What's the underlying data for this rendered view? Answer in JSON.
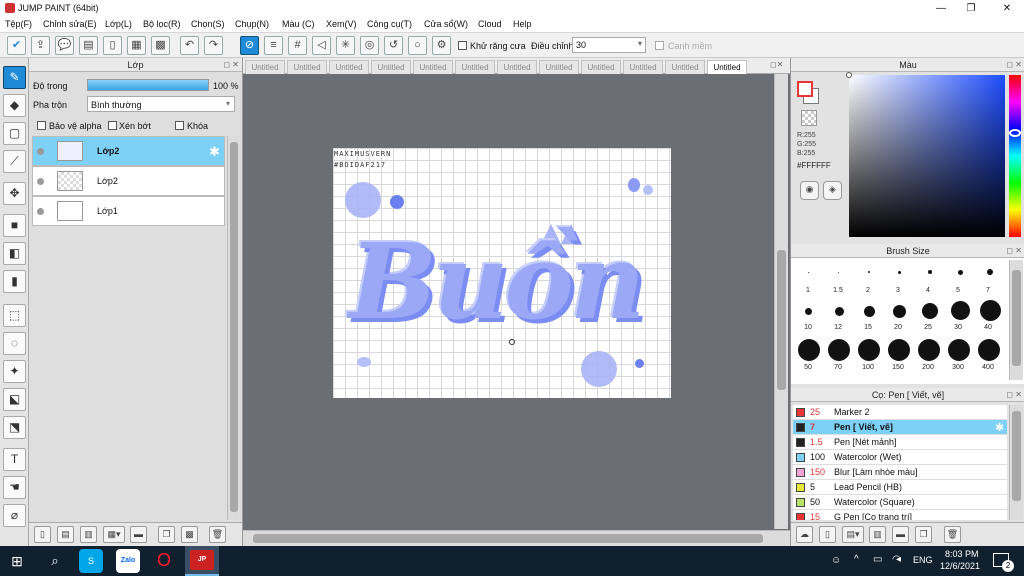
{
  "window": {
    "title": "JUMP PAINT (64bit)",
    "min": "—",
    "max": "❐",
    "close": "✕"
  },
  "menu": [
    "Tệp(F)",
    "Chỉnh sửa(E)",
    "Lớp(L)",
    "Bộ lọc(R)",
    "Chọn(S)",
    "Chụp(N)",
    "Màu (C)",
    "Xem(V)",
    "Công cụ(T)",
    "Cửa sổ(W)",
    "Cloud",
    "Help"
  ],
  "toolbar": {
    "antialias_label": "Khử răng cưa",
    "adjust_label": "Điều chỉnh",
    "adjust_value": "30",
    "snap_label": "Canh mềm"
  },
  "layer_panel": {
    "title": "Lớp",
    "opacity_label": "Độ trong",
    "opacity_value": "100 %",
    "opacity_fraction": 1.0,
    "blend_label": "Pha trộn",
    "blend_value": "Bình thường",
    "protect_alpha": "Bảo vệ alpha",
    "clip": "Xén bớt",
    "lock": "Khóa",
    "layers": [
      {
        "name": "Lớp2",
        "selected": true
      },
      {
        "name": "Lớp2",
        "selected": false
      },
      {
        "name": "Lớp1",
        "selected": false
      }
    ]
  },
  "tabs": [
    "Untitled",
    "Untitled",
    "Untitled",
    "Untitled",
    "Untitled",
    "Untitled",
    "Untitled",
    "Untitled",
    "Untitled",
    "Untitled",
    "Untitled",
    "Untitled"
  ],
  "active_tab": 11,
  "artwork": {
    "main_text": "Buồn",
    "corner_text_1": "MAXIMUSVERN",
    "corner_text_2": "#BOIDAF217",
    "fill_color": "#9aa8f5",
    "shade_color": "#6b7ff0"
  },
  "color_panel": {
    "title": "Màu",
    "r": "R:255",
    "g": "G:255",
    "b": "B:255",
    "hex": "#FFFFFF"
  },
  "brush_size_panel": {
    "title": "Brush Size",
    "sizes": [
      "1",
      "1.5",
      "2",
      "3",
      "4",
      "5",
      "7",
      "10",
      "12",
      "15",
      "20",
      "25",
      "30",
      "40",
      "50",
      "70",
      "100",
      "150",
      "200",
      "300",
      "400"
    ]
  },
  "brush_panel": {
    "title": "Cọ: Pen [ Viết, vẽ]",
    "brushes": [
      {
        "size": "25",
        "name": "Marker 2",
        "color": "#e83535",
        "selected": false
      },
      {
        "size": "7",
        "name": "Pen [ Viết, vẽ]",
        "color": "#222222",
        "selected": true
      },
      {
        "size": "1.5",
        "name": "Pen [Nét mảnh]",
        "color": "#222222",
        "selected": false
      },
      {
        "size": "100",
        "name": "Watercolor (Wet)",
        "color": "#7fd3f2",
        "selected": false
      },
      {
        "size": "150",
        "name": "Blur [Làm nhòe màu]",
        "color": "#f4a3d6",
        "selected": false
      },
      {
        "size": "5",
        "name": "Lead Pencil (HB)",
        "color": "#e8e83a",
        "selected": false
      },
      {
        "size": "50",
        "name": "Watercolor (Square)",
        "color": "#b8e26a",
        "selected": false
      },
      {
        "size": "15",
        "name": "G Pen [Cọ trang trí]",
        "color": "#e83535",
        "selected": false
      }
    ]
  },
  "taskbar": {
    "lang": "ENG",
    "time": "8:03 PM",
    "date": "12/6/2021",
    "notif_count": "2"
  }
}
